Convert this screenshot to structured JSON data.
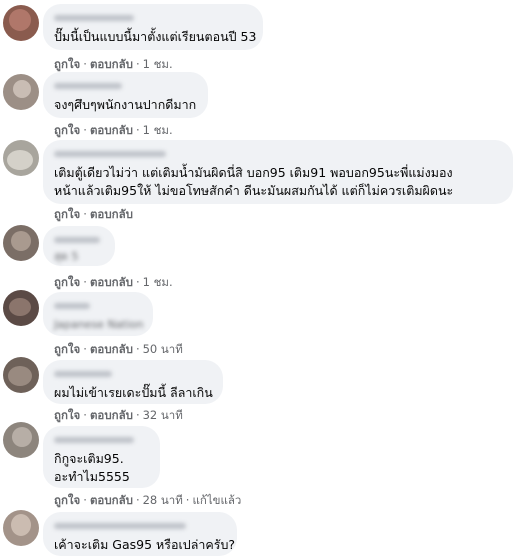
{
  "actions": {
    "like_label": "ถูกใจ",
    "reply_label": "ตอบกลับ",
    "separator": "·",
    "edited_label": "แก้ไขแล้ว"
  },
  "comments": [
    {
      "author_hidden": true,
      "lines": [
        "ปั๊มนี้เป็นแบบนี้มาตั้งแต่เรียนตอนปี 53"
      ],
      "time": "1 ชม."
    },
    {
      "author_hidden": true,
      "lines": [
        "จงๆศึบๆพนักงานปากดีมาก"
      ],
      "time": "1 ชม."
    },
    {
      "author_hidden": true,
      "lines": [
        "เติมตู้เดียวไม่ว่า แต่เติมน้ำมันผิดนี่สิ บอก95 เติม91 พอบอก95นะพี่แม่งมอง",
        "หน้าแล้วเติม95ให้ ไม่ขอโทษสักคำ ดีนะมันผสมกันได้ แต่ก็ไม่ควรเติมผิดนะ"
      ],
      "time": ""
    },
    {
      "author_hidden": true,
      "lines": [
        "สุด 5"
      ],
      "lines_blurred": true,
      "time": "1 ชม."
    },
    {
      "author_hidden": true,
      "lines": [
        "Japanese Nation"
      ],
      "lines_blurred": true,
      "time": "50 นาที"
    },
    {
      "author_hidden": true,
      "lines": [
        "ผมไม่เข้าเรยเดะปั๊มนี้ ลีลาเกิน"
      ],
      "time": "32 นาที"
    },
    {
      "author_hidden": true,
      "lines": [
        "กิกูจะเติม95.",
        "อะทำไม5555"
      ],
      "time": "28 นาที",
      "edited": true
    },
    {
      "author_hidden": true,
      "lines": [
        "เค้าจะเติม Gas95 หรือเปล่าครับ?"
      ],
      "time": ""
    }
  ]
}
